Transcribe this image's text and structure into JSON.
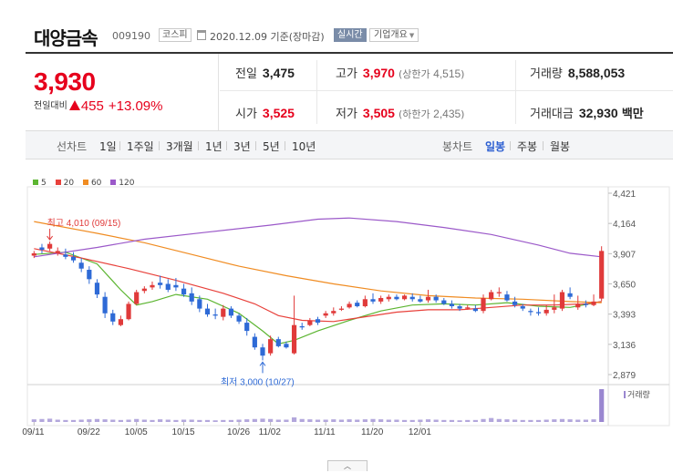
{
  "stock": {
    "name": "대양금속",
    "code": "009190",
    "market": "코스피",
    "basis": "2020.12.09 기준(장마감)",
    "realtime_label": "실시간",
    "company_label": "기업개요"
  },
  "summary": {
    "price": "3,930",
    "change_label": "전일대비",
    "change_amount": "455",
    "change_pct": "+13.09%",
    "prev_label": "전일",
    "prev": "3,475",
    "open_label": "시가",
    "open": "3,525",
    "high_label": "고가",
    "high": "3,970",
    "upper_label": "상한가",
    "upper": "4,515",
    "low_label": "저가",
    "low": "3,505",
    "lower_label": "하한가",
    "lower": "2,435",
    "volume_label": "거래량",
    "volume": "8,588,053",
    "amount_label": "거래대금",
    "amount": "32,930",
    "amount_unit": "백만"
  },
  "periods": {
    "line_label": "선차트",
    "line_items": [
      "1일",
      "1주일",
      "3개월",
      "1년",
      "3년",
      "5년",
      "10년"
    ],
    "candle_label": "봉차트",
    "candle_items": [
      "일봉",
      "주봉",
      "월봉"
    ],
    "active": "일봉"
  },
  "legend": [
    {
      "label": "5",
      "color": "#5cb531"
    },
    {
      "label": "20",
      "color": "#e8413b"
    },
    {
      "label": "60",
      "color": "#f08c22"
    },
    {
      "label": "120",
      "color": "#9b59c9"
    }
  ],
  "colors": {
    "up": "#e03a3a",
    "down": "#2e6ad6",
    "volume": "#b3a7dc",
    "volume_today": "#9a87d0"
  },
  "scroll_icon": "chevron-up-icon",
  "chart_data": {
    "type": "candlestick",
    "y_ticks": [
      "4,421",
      "4,164",
      "3,907",
      "3,650",
      "3,393",
      "3,136",
      "2,879"
    ],
    "ylim": [
      2879,
      4421
    ],
    "x_labels": [
      "09/11",
      "09/22",
      "10/05",
      "10/15",
      "10/26",
      "11/02",
      "11/11",
      "11/20",
      "12/01"
    ],
    "x_label_index": [
      0,
      7,
      13,
      19,
      26,
      30,
      37,
      43,
      49
    ],
    "high_annotation": "최고 4,010 (09/15)",
    "low_annotation": "최저 3,000 (10/27)",
    "volume_legend": "거래량",
    "candles": [
      {
        "o": 3890,
        "h": 3930,
        "c": 3910,
        "l": 3870
      },
      {
        "o": 3960,
        "h": 3990,
        "c": 3940,
        "l": 3910
      },
      {
        "o": 3950,
        "h": 4010,
        "c": 3990,
        "l": 3930
      },
      {
        "o": 3910,
        "h": 3960,
        "c": 3930,
        "l": 3890
      },
      {
        "o": 3900,
        "h": 3950,
        "c": 3880,
        "l": 3860
      },
      {
        "o": 3880,
        "h": 3920,
        "c": 3850,
        "l": 3830
      },
      {
        "o": 3830,
        "h": 3870,
        "c": 3780,
        "l": 3750
      },
      {
        "o": 3770,
        "h": 3800,
        "c": 3690,
        "l": 3650
      },
      {
        "o": 3660,
        "h": 3690,
        "c": 3560,
        "l": 3530
      },
      {
        "o": 3540,
        "h": 3580,
        "c": 3400,
        "l": 3360
      },
      {
        "o": 3400,
        "h": 3430,
        "c": 3330,
        "l": 3300
      },
      {
        "o": 3300,
        "h": 3380,
        "c": 3350,
        "l": 3290
      },
      {
        "o": 3350,
        "h": 3500,
        "c": 3480,
        "l": 3340
      },
      {
        "o": 3480,
        "h": 3600,
        "c": 3580,
        "l": 3470
      },
      {
        "o": 3590,
        "h": 3630,
        "c": 3610,
        "l": 3570
      },
      {
        "o": 3620,
        "h": 3670,
        "c": 3640,
        "l": 3600
      },
      {
        "o": 3660,
        "h": 3720,
        "c": 3640,
        "l": 3610
      },
      {
        "o": 3650,
        "h": 3690,
        "c": 3600,
        "l": 3580
      },
      {
        "o": 3640,
        "h": 3700,
        "c": 3620,
        "l": 3590
      },
      {
        "o": 3610,
        "h": 3650,
        "c": 3560,
        "l": 3540
      },
      {
        "o": 3570,
        "h": 3620,
        "c": 3500,
        "l": 3470
      },
      {
        "o": 3520,
        "h": 3550,
        "c": 3440,
        "l": 3410
      },
      {
        "o": 3440,
        "h": 3480,
        "c": 3390,
        "l": 3370
      },
      {
        "o": 3390,
        "h": 3440,
        "c": 3380,
        "l": 3350
      },
      {
        "o": 3370,
        "h": 3470,
        "c": 3440,
        "l": 3340
      },
      {
        "o": 3440,
        "h": 3460,
        "c": 3380,
        "l": 3360
      },
      {
        "o": 3380,
        "h": 3400,
        "c": 3330,
        "l": 3310
      },
      {
        "o": 3320,
        "h": 3360,
        "c": 3250,
        "l": 3210
      },
      {
        "o": 3200,
        "h": 3230,
        "c": 3110,
        "l": 3090
      },
      {
        "o": 3110,
        "h": 3140,
        "c": 3040,
        "l": 3000
      },
      {
        "o": 3060,
        "h": 3210,
        "c": 3180,
        "l": 3040
      },
      {
        "o": 3180,
        "h": 3200,
        "c": 3120,
        "l": 3110
      },
      {
        "o": 3140,
        "h": 3160,
        "c": 3110,
        "l": 3100
      },
      {
        "o": 3060,
        "h": 3550,
        "c": 3300,
        "l": 3050
      },
      {
        "o": 3290,
        "h": 3320,
        "c": 3280,
        "l": 3260
      },
      {
        "o": 3300,
        "h": 3360,
        "c": 3340,
        "l": 3290
      },
      {
        "o": 3350,
        "h": 3370,
        "c": 3320,
        "l": 3300
      },
      {
        "o": 3380,
        "h": 3420,
        "c": 3400,
        "l": 3360
      },
      {
        "o": 3400,
        "h": 3450,
        "c": 3420,
        "l": 3380
      },
      {
        "o": 3430,
        "h": 3460,
        "c": 3440,
        "l": 3420
      },
      {
        "o": 3450,
        "h": 3500,
        "c": 3480,
        "l": 3440
      },
      {
        "o": 3490,
        "h": 3510,
        "c": 3460,
        "l": 3450
      },
      {
        "o": 3460,
        "h": 3550,
        "c": 3520,
        "l": 3450
      },
      {
        "o": 3520,
        "h": 3570,
        "c": 3500,
        "l": 3480
      },
      {
        "o": 3500,
        "h": 3550,
        "c": 3530,
        "l": 3480
      },
      {
        "o": 3520,
        "h": 3560,
        "c": 3540,
        "l": 3500
      },
      {
        "o": 3540,
        "h": 3560,
        "c": 3520,
        "l": 3510
      },
      {
        "o": 3520,
        "h": 3560,
        "c": 3550,
        "l": 3510
      },
      {
        "o": 3540,
        "h": 3570,
        "c": 3520,
        "l": 3500
      },
      {
        "o": 3520,
        "h": 3550,
        "c": 3500,
        "l": 3490
      },
      {
        "o": 3510,
        "h": 3600,
        "c": 3540,
        "l": 3490
      },
      {
        "o": 3540,
        "h": 3560,
        "c": 3510,
        "l": 3490
      },
      {
        "o": 3510,
        "h": 3530,
        "c": 3480,
        "l": 3470
      },
      {
        "o": 3480,
        "h": 3510,
        "c": 3460,
        "l": 3440
      },
      {
        "o": 3460,
        "h": 3480,
        "c": 3440,
        "l": 3420
      },
      {
        "o": 3440,
        "h": 3470,
        "c": 3450,
        "l": 3430
      },
      {
        "o": 3440,
        "h": 3470,
        "c": 3420,
        "l": 3410
      },
      {
        "o": 3420,
        "h": 3560,
        "c": 3530,
        "l": 3400
      },
      {
        "o": 3520,
        "h": 3600,
        "c": 3580,
        "l": 3510
      },
      {
        "o": 3570,
        "h": 3620,
        "c": 3580,
        "l": 3540
      },
      {
        "o": 3560,
        "h": 3590,
        "c": 3510,
        "l": 3500
      },
      {
        "o": 3500,
        "h": 3540,
        "c": 3470,
        "l": 3450
      },
      {
        "o": 3460,
        "h": 3480,
        "c": 3440,
        "l": 3420
      },
      {
        "o": 3420,
        "h": 3440,
        "c": 3410,
        "l": 3380
      },
      {
        "o": 3410,
        "h": 3450,
        "c": 3400,
        "l": 3380
      },
      {
        "o": 3400,
        "h": 3470,
        "c": 3430,
        "l": 3380
      },
      {
        "o": 3430,
        "h": 3560,
        "c": 3450,
        "l": 3400
      },
      {
        "o": 3440,
        "h": 3600,
        "c": 3580,
        "l": 3420
      },
      {
        "o": 3570,
        "h": 3620,
        "c": 3540,
        "l": 3520
      },
      {
        "o": 3450,
        "h": 3550,
        "c": 3480,
        "l": 3430
      },
      {
        "o": 3480,
        "h": 3510,
        "c": 3470,
        "l": 3450
      },
      {
        "o": 3470,
        "h": 3560,
        "c": 3500,
        "l": 3460
      },
      {
        "o": 3525,
        "h": 3970,
        "c": 3930,
        "l": 3505
      }
    ],
    "volume": [
      8,
      9,
      10,
      7,
      6,
      6,
      7,
      8,
      9,
      8,
      7,
      6,
      7,
      9,
      7,
      6,
      8,
      7,
      6,
      7,
      7,
      6,
      6,
      5,
      6,
      6,
      7,
      8,
      9,
      10,
      9,
      7,
      7,
      14,
      9,
      8,
      7,
      7,
      8,
      7,
      8,
      7,
      8,
      9,
      8,
      7,
      7,
      6,
      6,
      7,
      8,
      7,
      6,
      6,
      5,
      6,
      6,
      9,
      12,
      9,
      8,
      7,
      6,
      6,
      6,
      7,
      8,
      9,
      8,
      7,
      7,
      8,
      100
    ],
    "ma": {
      "ma5": [
        [
          0,
          3900
        ],
        [
          4,
          3920
        ],
        [
          8,
          3820
        ],
        [
          11,
          3600
        ],
        [
          13,
          3470
        ],
        [
          15,
          3500
        ],
        [
          18,
          3560
        ],
        [
          22,
          3520
        ],
        [
          26,
          3400
        ],
        [
          29,
          3250
        ],
        [
          31,
          3140
        ],
        [
          33,
          3170
        ],
        [
          36,
          3250
        ],
        [
          40,
          3340
        ],
        [
          44,
          3420
        ],
        [
          48,
          3470
        ],
        [
          52,
          3480
        ],
        [
          56,
          3470
        ],
        [
          60,
          3490
        ],
        [
          64,
          3460
        ],
        [
          68,
          3450
        ],
        [
          72,
          3500
        ]
      ],
      "ma20": [
        [
          0,
          3950
        ],
        [
          6,
          3870
        ],
        [
          12,
          3780
        ],
        [
          18,
          3680
        ],
        [
          24,
          3570
        ],
        [
          28,
          3480
        ],
        [
          31,
          3380
        ],
        [
          34,
          3340
        ],
        [
          38,
          3330
        ],
        [
          42,
          3370
        ],
        [
          46,
          3410
        ],
        [
          50,
          3430
        ],
        [
          54,
          3430
        ],
        [
          58,
          3450
        ],
        [
          62,
          3470
        ],
        [
          66,
          3470
        ],
        [
          70,
          3480
        ],
        [
          72,
          3500
        ]
      ],
      "ma60": [
        [
          0,
          4180
        ],
        [
          8,
          4080
        ],
        [
          14,
          4000
        ],
        [
          20,
          3900
        ],
        [
          26,
          3800
        ],
        [
          32,
          3720
        ],
        [
          38,
          3650
        ],
        [
          44,
          3590
        ],
        [
          50,
          3550
        ],
        [
          56,
          3530
        ],
        [
          62,
          3520
        ],
        [
          68,
          3500
        ],
        [
          72,
          3490
        ]
      ],
      "ma120": [
        [
          0,
          3880
        ],
        [
          8,
          3960
        ],
        [
          14,
          4030
        ],
        [
          22,
          4090
        ],
        [
          30,
          4150
        ],
        [
          36,
          4200
        ],
        [
          40,
          4210
        ],
        [
          46,
          4180
        ],
        [
          52,
          4130
        ],
        [
          58,
          4070
        ],
        [
          64,
          3980
        ],
        [
          68,
          3910
        ],
        [
          72,
          3880
        ]
      ]
    }
  }
}
